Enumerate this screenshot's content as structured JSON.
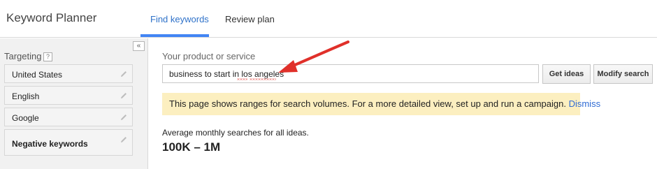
{
  "header": {
    "app_title": "Keyword Planner",
    "tabs": [
      {
        "label": "Find keywords",
        "active": true
      },
      {
        "label": "Review plan",
        "active": false
      }
    ]
  },
  "sidebar": {
    "collapse_glyph": "«",
    "targeting_label": "Targeting",
    "help_glyph": "?",
    "items": [
      {
        "label": "United States",
        "icon": "pencil-icon"
      },
      {
        "label": "English",
        "icon": "pencil-icon"
      },
      {
        "label": "Google",
        "icon": "pencil-icon"
      },
      {
        "label": "Negative keywords",
        "icon": "pencil-icon"
      }
    ]
  },
  "main": {
    "product_label": "Your product or service",
    "search_value": "business to start in los angeles",
    "get_ideas_label": "Get ideas",
    "modify_search_label": "Modify search",
    "notice_text": "This page shows ranges for search volumes. For a more detailed view, set up and run a campaign. ",
    "notice_link": "Dismiss",
    "avg_label": "Average monthly searches for all ideas.",
    "avg_value": "100K – 1M"
  },
  "colors": {
    "accent_tab": "#4285f4",
    "notice_bg": "#fcefc0",
    "link": "#2f6bd4",
    "annotation_arrow": "#e0302a"
  }
}
